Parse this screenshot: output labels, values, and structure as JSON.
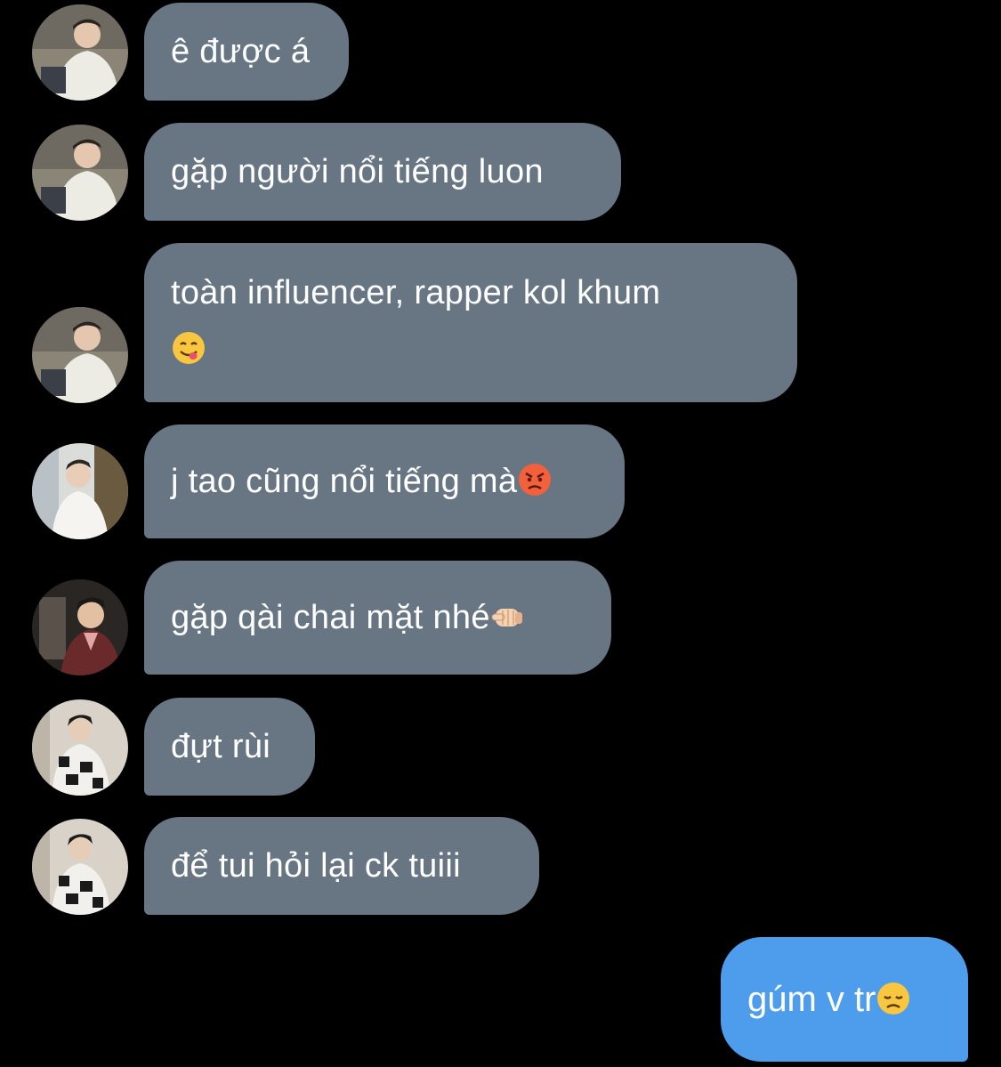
{
  "messages": [
    {
      "sender": "avatar-a",
      "text": "ê được á",
      "emoji": ""
    },
    {
      "sender": "avatar-a",
      "text": "gặp người nổi tiếng luon",
      "emoji": ""
    },
    {
      "sender": "avatar-a",
      "text": "toàn influencer, rapper kol khum",
      "emoji": "yum-emoji"
    },
    {
      "sender": "avatar-b",
      "text": "j tao cũng nổi tiếng mà",
      "emoji": "angry-emoji"
    },
    {
      "sender": "avatar-c",
      "text": "gặp qài chai mặt nhé",
      "emoji": "pointing-fist-emoji"
    },
    {
      "sender": "avatar-d",
      "text": "đựt rùi",
      "emoji": ""
    },
    {
      "sender": "avatar-d",
      "text": "để tui hỏi lại ck tuiii",
      "emoji": ""
    }
  ],
  "outgoing": {
    "text": "gúm v tr",
    "emoji": "disappointed-emoji"
  },
  "colors": {
    "background": "#000000",
    "incoming_bubble": "#687684",
    "outgoing_bubble": "#4e9ded",
    "text": "#ffffff"
  }
}
